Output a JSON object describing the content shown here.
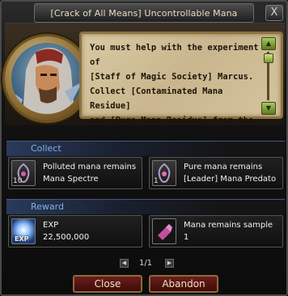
{
  "window": {
    "title": "[Crack of All Means] Uncontrollable Mana",
    "close_glyph": "X"
  },
  "dialog": {
    "text": "You must help with the experiment of\n[Staff of Magic Society] Marcus.\nCollect [Contaminated Mana Residue]\nand [Pure Mana Residue] from the"
  },
  "collect": {
    "title": "Collect",
    "items": [
      {
        "count": "10",
        "line1": "Polluted mana remains",
        "line2": "Mana Spectre"
      },
      {
        "count": "1",
        "line1": "Pure mana remains",
        "line2": "[Leader] Mana Predato"
      }
    ]
  },
  "reward": {
    "title": "Reward",
    "items": [
      {
        "icon_label": "EXP",
        "line1": "EXP",
        "line2": "22,500,000"
      },
      {
        "line1": "Mana remains sample",
        "line2": "1"
      }
    ]
  },
  "pager": {
    "label": "1/1",
    "prev": "◀",
    "next": "▶"
  },
  "buttons": {
    "close": "Close",
    "abandon": "Abandon"
  },
  "colors": {
    "section_title": "#7fb0e6",
    "button_bg": "#6c1e1a",
    "dialog_bg": "#d8c9a3"
  }
}
